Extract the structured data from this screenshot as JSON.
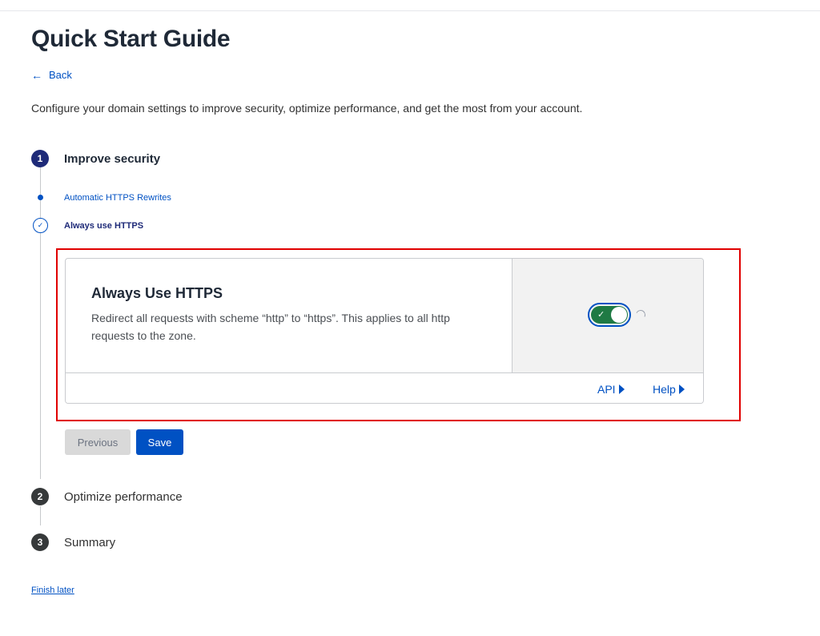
{
  "header": {
    "title": "Quick Start Guide",
    "back_label": "Back",
    "intro": "Configure your domain settings to improve security, optimize performance, and get the most from your account."
  },
  "steps": [
    {
      "number": "1",
      "title": "Improve security",
      "substeps": [
        {
          "label": "Automatic HTTPS Rewrites",
          "state": "completed"
        },
        {
          "label": "Always use HTTPS",
          "state": "current"
        }
      ]
    },
    {
      "number": "2",
      "title": "Optimize performance"
    },
    {
      "number": "3",
      "title": "Summary"
    }
  ],
  "setting_card": {
    "title": "Always Use HTTPS",
    "description": "Redirect all requests with scheme “http” to “https”. This applies to all http requests to the zone.",
    "toggle_on": true,
    "api_label": "API",
    "help_label": "Help"
  },
  "actions": {
    "previous_label": "Previous",
    "save_label": "Save",
    "finish_later_label": "Finish later"
  },
  "colors": {
    "accent": "#0051c3",
    "active_step": "#1e2a78",
    "toggle_on": "#1f7a44",
    "highlight": "#e00000"
  }
}
